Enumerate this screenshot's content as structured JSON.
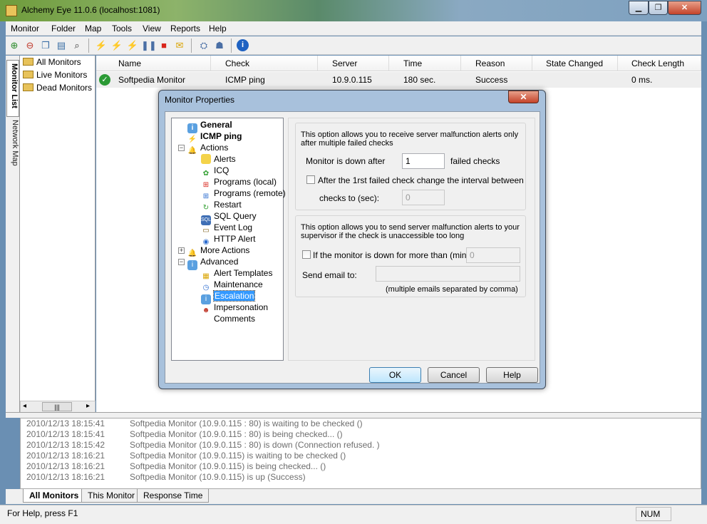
{
  "window": {
    "title": "Alchemy Eye 11.0.6 (localhost:1081)",
    "minimize": "▁",
    "maximize": "❐",
    "close": "✕"
  },
  "menu": [
    "Monitor",
    "Folder",
    "Map",
    "Tools",
    "View",
    "Reports",
    "Help"
  ],
  "side_tabs": {
    "monitor_list": "Monitor List",
    "network_map": "Network Map"
  },
  "folders": [
    "All Monitors",
    "Live Monitors",
    "Dead Monitors"
  ],
  "scrollbar": {
    "left": "◂",
    "thumb": "|||",
    "right": "▸"
  },
  "table": {
    "headers": [
      "Name",
      "Check",
      "Server",
      "Time",
      "Reason",
      "State Changed",
      "Check Length"
    ],
    "rows": [
      {
        "name": "Softpedia Monitor",
        "check": "ICMP ping",
        "server": "10.9.0.115",
        "time": "180 sec.",
        "reason": "Success",
        "state_changed": "",
        "check_length": "0 ms.",
        "status_glyph": "✓"
      }
    ]
  },
  "log": [
    {
      "time": "2010/12/13 18:15:41",
      "msg": "Softpedia Monitor (10.9.0.115 : 80) is waiting to be checked ()"
    },
    {
      "time": "2010/12/13 18:15:41",
      "msg": "Softpedia Monitor (10.9.0.115 : 80) is being checked... ()"
    },
    {
      "time": "2010/12/13 18:15:42",
      "msg": "Softpedia Monitor (10.9.0.115 : 80) is down (Connection refused. )"
    },
    {
      "time": "2010/12/13 18:16:21",
      "msg": "Softpedia Monitor (10.9.0.115) is waiting to be checked ()"
    },
    {
      "time": "2010/12/13 18:16:21",
      "msg": "Softpedia Monitor (10.9.0.115) is being checked... ()"
    },
    {
      "time": "2010/12/13 18:16:21",
      "msg": "Softpedia Monitor (10.9.0.115) is up (Success)"
    }
  ],
  "bottom_tabs": [
    "All Monitors",
    "This Monitor",
    "Response Time"
  ],
  "status": {
    "help": "For Help, press F1",
    "num": "NUM"
  },
  "dialog": {
    "title": "Monitor Properties",
    "close": "✕",
    "tree": {
      "general": "General",
      "icmp": "ICMP ping",
      "actions": "Actions",
      "alerts": "Alerts",
      "icq": "ICQ",
      "programs_local": "Programs (local)",
      "programs_remote": "Programs (remote)",
      "restart": "Restart",
      "sql_query": "SQL Query",
      "event_log": "Event Log",
      "http_alert": "HTTP Alert",
      "more_actions": "More Actions",
      "advanced": "Advanced",
      "alert_templates": "Alert Templates",
      "maintenance": "Maintenance",
      "escalation": "Escalation",
      "impersonation": "Impersonation",
      "comments": "Comments",
      "expand_plus": "+",
      "expand_minus": "−"
    },
    "group1": {
      "desc": "This option allows you to receive server malfunction alerts only after multiple failed checks",
      "down_after_label": "Monitor is down after",
      "down_after_value": "1",
      "failed_checks": "failed checks",
      "interval_checkbox": "After the 1rst failed check change the interval between",
      "checks_to_label": "checks to (sec):",
      "checks_to_value": "0"
    },
    "group2": {
      "desc": "This option allows you to send server malfunction alerts to your supervisor if the check is unaccessible too long",
      "down_more_checkbox": "If the monitor is down for more than (min):",
      "down_more_value": "0",
      "send_email_label": "Send email to:",
      "send_email_value": "",
      "hint": "(multiple emails separated by comma)"
    },
    "buttons": {
      "ok": "OK",
      "cancel": "Cancel",
      "help": "Help"
    }
  },
  "colors": {
    "accent": "#3399ff",
    "ok_green": "#2b9a35",
    "dialog_frame": "#a8c1dc"
  }
}
